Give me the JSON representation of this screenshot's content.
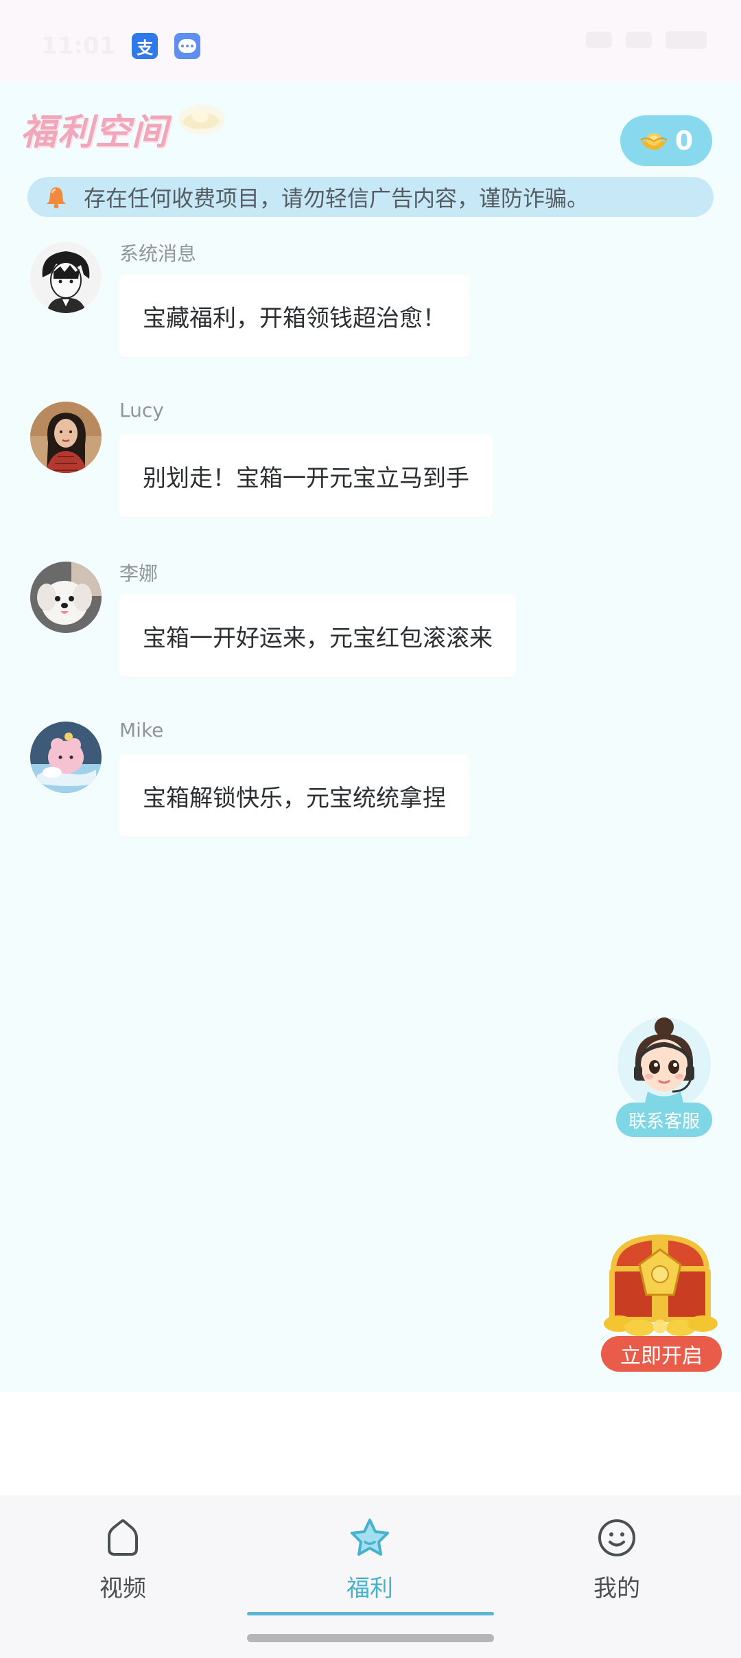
{
  "status_bar": {
    "time": "11:01",
    "app_icons": [
      "alipay-icon",
      "message-icon"
    ],
    "alipay_glyph": "支"
  },
  "header": {
    "brand_title": "福利空间",
    "coin_count": "0"
  },
  "notice": {
    "text": "存在任何收费项目，请勿轻信广告内容，谨防诈骗。"
  },
  "messages": [
    {
      "sender": "系统消息",
      "text": "宝藏福利，开箱领钱超治愈！",
      "avatar": "anime-boy-avatar"
    },
    {
      "sender": "Lucy",
      "text": "别划走！宝箱一开元宝立马到手",
      "avatar": "woman-avatar"
    },
    {
      "sender": "李娜",
      "text": "宝箱一开好运来，元宝红包滚滚来",
      "avatar": "puppy-avatar"
    },
    {
      "sender": "Mike",
      "text": "宝箱解锁快乐，元宝统统拿捏",
      "avatar": "pink-creature-avatar"
    }
  ],
  "floating": {
    "service_label": "联系客服",
    "treasure_label": "立即开启"
  },
  "nav": {
    "items": [
      {
        "label": "视频",
        "icon": "home-icon",
        "active": false
      },
      {
        "label": "福利",
        "icon": "star-icon",
        "active": true
      },
      {
        "label": "我的",
        "icon": "smiley-icon",
        "active": false
      }
    ]
  },
  "colors": {
    "accent": "#47b2cd",
    "coin_pill": "#88d9ee",
    "notice_bg": "#c7e9f7",
    "treasure_button": "#e95c4a",
    "brand_pink": "#f2a6b9"
  }
}
